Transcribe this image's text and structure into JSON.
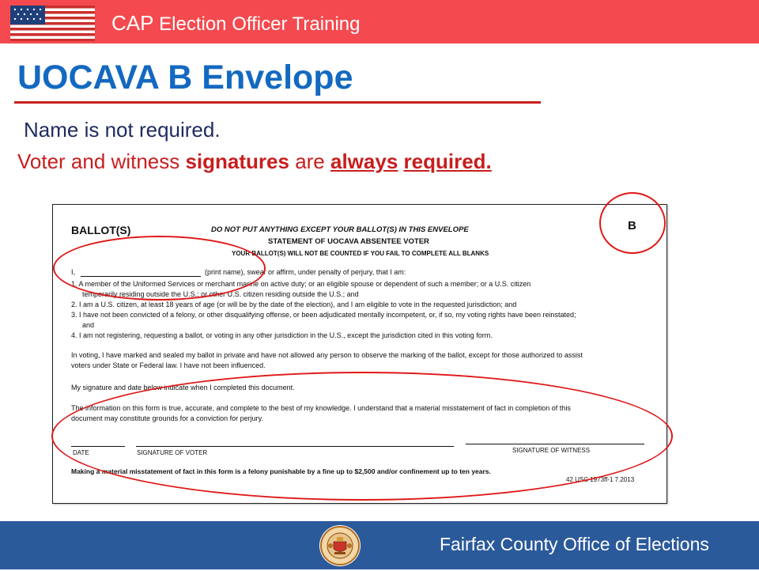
{
  "header": {
    "title_prefix": "CAP",
    "title_rest": " Election Officer Training",
    "flag_icon": "us-flag-icon"
  },
  "slide": {
    "title": "UOCAVA B Envelope",
    "line1": "Name is not required.",
    "line2_a": "Voter and witness ",
    "line2_b": "signatures",
    "line2_c": " are ",
    "line2_d": "always",
    "line2_e": " ",
    "line2_f": "required."
  },
  "form": {
    "ballot_label": "BALLOT(S)",
    "instruction": "DO NOT PUT ANYTHING EXCEPT YOUR BALLOT(S) IN THIS ENVELOPE",
    "statement_title": "STATEMENT OF UOCAVA ABSENTEE VOTER",
    "warning": "YOUR BALLOT(S) WILL NOT BE COUNTED IF YOU FAIL TO COMPLETE ALL BLANKS",
    "envelope_letter": "B",
    "intro_i": "I,",
    "intro_rest": "(print name), swear or affirm, under penalty of perjury, that I am:",
    "item1a": "1.  A member of the Uniformed Services or merchant marine on active duty;  or an eligible spouse or dependent of such a member; or a U.S. citizen",
    "item1b": "temporarily residing outside the U.S.; or other U.S. citizen residing outside the U.S.; and",
    "item2": "2.  I am a U.S. citizen, at least 18 years of age (or will be by the date of the election), and I am eligible to vote in the requested jurisdiction; and",
    "item3a": "3.  I have not been convicted of a felony, or other disqualifying offense, or been adjudicated mentally incompetent, or, if so, my voting rights have been reinstated;",
    "item3b": "and",
    "item4": "4.  I am not registering, requesting a ballot, or voting in any other jurisdiction in the U.S., except the jurisdiction cited in this voting form.",
    "para1a": "In voting, I have marked and sealed my ballot in private and have not allowed any person to observe the marking of the ballot, except for those authorized to assist",
    "para1b": "voters under State or Federal law.  I have not been influenced.",
    "para2": "My signature and date below indicate when I completed this document.",
    "para3a": "The information on this form is true, accurate, and complete to the best of my knowledge.  I understand that a material misstatement of fact in completion of this",
    "para3b": "document may constitute grounds for a conviction for perjury.",
    "date_label": "DATE",
    "voter_sig_label": "SIGNATURE OF VOTER",
    "witness_sig_label": "SIGNATURE OF WITNESS",
    "penalty": "Making a material misstatement of fact in this form is a felony punishable by a fine up to $2,500 and/or confinement up to ten years.",
    "form_code": "42 USC 1973ff-1   7.2013"
  },
  "footer": {
    "org": "Fairfax County Office of Elections",
    "seal_icon": "county-seal-icon"
  },
  "colors": {
    "header_bg": "#f44a4f",
    "title_blue": "#1369c0",
    "emphasis_red": "#c81e1e",
    "footer_bg": "#2b5a9b"
  }
}
